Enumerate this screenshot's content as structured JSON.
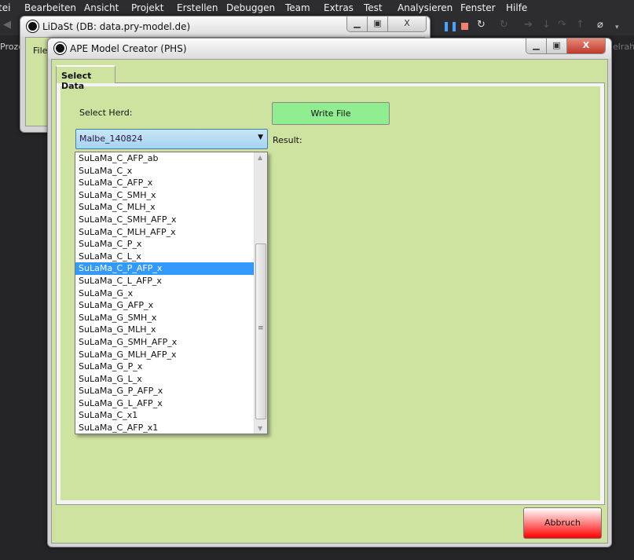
{
  "menu": [
    "tei",
    "Bearbeiten",
    "Ansicht",
    "Projekt",
    "Erstellen",
    "Debuggen",
    "Team",
    "Extras",
    "Test",
    "Analysieren",
    "Fenster",
    "Hilfe"
  ],
  "background_text": {
    "left": "Proze",
    "right": "elrahn"
  },
  "lidast_window": {
    "title": "LiDaSt (DB: data.pry-model.de)",
    "menu_file": "File",
    "close_label": "X"
  },
  "ape_window": {
    "title": "APE Model Creator (PHS)",
    "close_label": "X",
    "tab": "Select Data",
    "select_herd_label": "Select Herd:",
    "herd_combo_value": "Malbe_140824",
    "write_file_button": "Write File",
    "result_label": "Result:",
    "cancel_button": "Abbruch",
    "dropdown_items": [
      "SuLaMa_C_AFP_ab",
      "SuLaMa_C_x",
      "SuLaMa_C_AFP_x",
      "SuLaMa_C_SMH_x",
      "SuLaMa_C_MLH_x",
      "SuLaMa_C_SMH_AFP_x",
      "SuLaMa_C_MLH_AFP_x",
      "SuLaMa_C_P_x",
      "SuLaMa_C_L_x",
      "SuLaMa_C_P_AFP_x",
      "SuLaMa_C_L_AFP_x",
      "SuLaMa_G_x",
      "SuLaMa_G_AFP_x",
      "SuLaMa_G_SMH_x",
      "SuLaMa_G_MLH_x",
      "SuLaMa_G_SMH_AFP_x",
      "SuLaMa_G_MLH_AFP_x",
      "SuLaMa_G_P_x",
      "SuLaMa_G_L_x",
      "SuLaMa_G_P_AFP_x",
      "SuLaMa_G_L_AFP_x",
      "SuLaMa_C_x1",
      "SuLaMa_C_AFP_x1"
    ],
    "selected_item": "SuLaMa_C_P_AFP_x"
  },
  "colors": {
    "panel_green": "#cfe3a0",
    "write_button": "#90ee90",
    "cancel_button": "#ff0000",
    "selection": "#3399ff"
  }
}
